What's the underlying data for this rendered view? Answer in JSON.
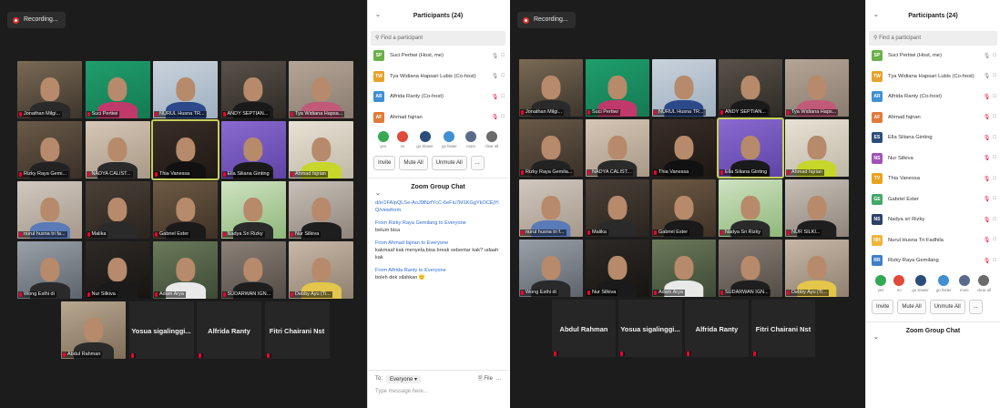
{
  "recording_label": "Recording...",
  "participants_title": "Participants (24)",
  "search_placeholder": "Find a participant",
  "participants": [
    {
      "initials": "SP",
      "name": "Suci Pertiwi (Host, me)",
      "color": "#6bb04a"
    },
    {
      "initials": "TW",
      "name": "Tya Widiana Hapsari Lubis (Co-host)",
      "color": "#e6a32c"
    },
    {
      "initials": "AR",
      "name": "Alfrida Ranty (Co-host)",
      "color": "#3f8fd2"
    },
    {
      "initials": "AF",
      "name": "Ahmad fajrian",
      "color": "#e07b3a"
    },
    {
      "initials": "ES",
      "name": "Ella Siliana Ginting",
      "color": "#2b4d7a"
    },
    {
      "initials": "NS",
      "name": "Nur Silkiva",
      "color": "#a052b8"
    },
    {
      "initials": "TV",
      "name": "Thia Vanessa",
      "color": "#e8a21f"
    },
    {
      "initials": "GE",
      "name": "Gabriel Ester",
      "color": "#42a86a"
    },
    {
      "initials": "NS",
      "name": "Nadya sri Rizky",
      "color": "#2e3f6a"
    },
    {
      "initials": "NH",
      "name": "Nurul Husna Tri Fadhila",
      "color": "#f0b33a"
    },
    {
      "initials": "RR",
      "name": "Rizky Raya Gemilang",
      "color": "#3f7fc8"
    }
  ],
  "reactions": [
    {
      "label": "yes",
      "color": "#34a853"
    },
    {
      "label": "no",
      "color": "#e04a3a"
    },
    {
      "label": "go slower",
      "color": "#2b4d7a"
    },
    {
      "label": "go faster",
      "color": "#3f8fd2"
    },
    {
      "label": "more",
      "color": "#5a6b8a"
    },
    {
      "label": "clear all",
      "color": "#6b6b6b"
    }
  ],
  "buttons": {
    "invite": "Invite",
    "mute_all": "Mute All",
    "unmute_all": "Unmute All",
    "more": "..."
  },
  "chat": {
    "title": "Zoom Group Chat",
    "link": "d/e/1FAIpQLSe-AoJ9lNzfYcC-6eFiu7M1KGgYkOCEjYiQ/viewform",
    "messages": [
      {
        "from": "From Rizky Raya Gemilang to Everyone",
        "text": "belum bisa"
      },
      {
        "from": "From Ahmad fajrian to Everyone",
        "text": "kakmaaf kak menyela,bisa break sebentar kak? udaah kak"
      },
      {
        "from": "From Alfrida Ranty to Everyone",
        "text": "boleh dek silahkan 🙂"
      }
    ],
    "to_label": "To:",
    "to_value": "Everyone",
    "file_label": "File",
    "type_placeholder": "Type message here..."
  },
  "tiles_a": [
    {
      "name": "Jonathan Milgi...",
      "c1": "#7a6a55",
      "c2": "#3d352c",
      "b": "#2a2a2a"
    },
    {
      "name": "Suci Pertiwi",
      "c1": "#1f9e6c",
      "c2": "#157a52",
      "b": "#c0396b"
    },
    {
      "name": "NURUL Husna TR...",
      "c1": "#c9d2dc",
      "c2": "#9fb0c0",
      "b": "#2c4a8a"
    },
    {
      "name": "ANDY SEPTIAN...",
      "c1": "#5a524a",
      "c2": "#2e2a26",
      "b": "#1a1a1a"
    },
    {
      "name": "Tya Widiana Hapsa...",
      "c1": "#b4a596",
      "c2": "#8a7c70",
      "b": "#c05a78"
    },
    {
      "name": "Rizky Raya Gemi...",
      "c1": "#6a5a48",
      "c2": "#3a3028",
      "b": "#222222"
    },
    {
      "name": "NADYA CALIST...",
      "c1": "#d6c7b6",
      "c2": "#a89886",
      "b": "#2a2a2a"
    },
    {
      "name": "Thia Vanessa",
      "c1": "#3a2e28",
      "c2": "#1e1814",
      "b": "#111111",
      "active": true
    },
    {
      "name": "Ella Siliana Ginting",
      "c1": "#8a6ad0",
      "c2": "#5e44a6",
      "b": "#1a1a1a"
    },
    {
      "name": "Ahmad fajrian",
      "c1": "#e8e2d6",
      "c2": "#c0b8a6",
      "b": "#c7d62a"
    },
    {
      "name": "nurul husna tri fa...",
      "c1": "#d0c8c0",
      "c2": "#a6988a",
      "b": "#5a7ab8"
    },
    {
      "name": "Malika",
      "c1": "#4a4038",
      "c2": "#2a241e",
      "b": "#2a2a2a"
    },
    {
      "name": "Gabriel Ester",
      "c1": "#6e5a44",
      "c2": "#3e3226",
      "b": "#1a1a1a"
    },
    {
      "name": "Nadya Sri Rizky",
      "c1": "#cfe2c2",
      "c2": "#8fb87a",
      "b": "#2a2a2a"
    },
    {
      "name": "Nur Silkiva",
      "c1": "#c8c0b8",
      "c2": "#8e847a",
      "b": "#1e1e1e"
    },
    {
      "name": "Wong Esthi di",
      "c1": "#9aa0a8",
      "c2": "#5e646c",
      "b": "#2a2a2a"
    },
    {
      "name": "Nur Silkiva",
      "c1": "#2e2a26",
      "c2": "#161412",
      "b": "#1a1a1a"
    },
    {
      "name": "Adam Arya",
      "c1": "#6a7a5a",
      "c2": "#3e4a36",
      "b": "#e9e9e9"
    },
    {
      "name": "SUDARWAN IGN...",
      "c1": "#8a8078",
      "c2": "#544c46",
      "b": "#1e1e1e"
    },
    {
      "name": "Debby Ayu (Ti...",
      "c1": "#c8b8a8",
      "c2": "#908070",
      "b": "#e3c64a"
    },
    {
      "name": "Abdul Rahman",
      "c1": "#b8a890",
      "c2": "#806e58",
      "b": "#2a2a2a"
    }
  ],
  "tiles_b": [
    {
      "name": "Jonathan Milgi...",
      "c1": "#7a6a55",
      "c2": "#3d352c",
      "b": "#2a2a2a"
    },
    {
      "name": "Suci Pertiwi",
      "c1": "#1f9e6c",
      "c2": "#157a52",
      "b": "#c0396b"
    },
    {
      "name": "NURUL Husna TR...",
      "c1": "#c9d2dc",
      "c2": "#9fb0c0",
      "b": "#2c4a8a"
    },
    {
      "name": "ANDY SEPTIAN...",
      "c1": "#5a524a",
      "c2": "#2e2a26",
      "b": "#1a1a1a"
    },
    {
      "name": "Tya Widiana Haps...",
      "c1": "#b4a596",
      "c2": "#8a7c70",
      "b": "#c05a78"
    },
    {
      "name": "Rizky Raya Gemila...",
      "c1": "#6a5a48",
      "c2": "#3a3028",
      "b": "#222222"
    },
    {
      "name": "NADYA CALIST...",
      "c1": "#d6c7b6",
      "c2": "#a89886",
      "b": "#2a2a2a"
    },
    {
      "name": "Thia Vanessa",
      "c1": "#3a2e28",
      "c2": "#1e1814",
      "b": "#111111"
    },
    {
      "name": "Ella Siliana Ginting",
      "c1": "#8a6ad0",
      "c2": "#5e44a6",
      "b": "#1a1a1a",
      "active": true
    },
    {
      "name": "Ahmad fajrian",
      "c1": "#e8e2d6",
      "c2": "#c0b8a6",
      "b": "#c7d62a"
    },
    {
      "name": "nurul husna tri f...",
      "c1": "#d0c8c0",
      "c2": "#a6988a",
      "b": "#5a7ab8"
    },
    {
      "name": "Malika",
      "c1": "#4a4038",
      "c2": "#2a241e",
      "b": "#2a2a2a"
    },
    {
      "name": "Gabriel Ester",
      "c1": "#6e5a44",
      "c2": "#3e3226",
      "b": "#1a1a1a"
    },
    {
      "name": "Nadya Sri Rizky",
      "c1": "#cfe2c2",
      "c2": "#8fb87a",
      "b": "#2a2a2a"
    },
    {
      "name": "NUR SILKI...",
      "c1": "#c8c0b8",
      "c2": "#8e847a",
      "b": "#1e1e1e"
    },
    {
      "name": "Wong Esthi di",
      "c1": "#9aa0a8",
      "c2": "#5e646c",
      "b": "#2a2a2a"
    },
    {
      "name": "Nur Silkiva",
      "c1": "#2e2a26",
      "c2": "#161412",
      "b": "#1a1a1a"
    },
    {
      "name": "Adam Arya",
      "c1": "#6a7a5a",
      "c2": "#3e4a36",
      "b": "#e9e9e9"
    },
    {
      "name": "SUDARWAN IGN...",
      "c1": "#8a8078",
      "c2": "#544c46",
      "b": "#1e1e1e"
    },
    {
      "name": "Debby Ayu (Ti...",
      "c1": "#c8b8a8",
      "c2": "#908070",
      "b": "#e3c64a"
    }
  ],
  "name_only_a": [
    "Yosua sigalinggi...",
    "Alfrida Ranty",
    "Fitri Chairani Nst"
  ],
  "name_only_b": [
    "Abdul Rahman",
    "Yosua sigalinggi...",
    "Alfrida Ranty",
    "Fitri Chairani Nst"
  ]
}
